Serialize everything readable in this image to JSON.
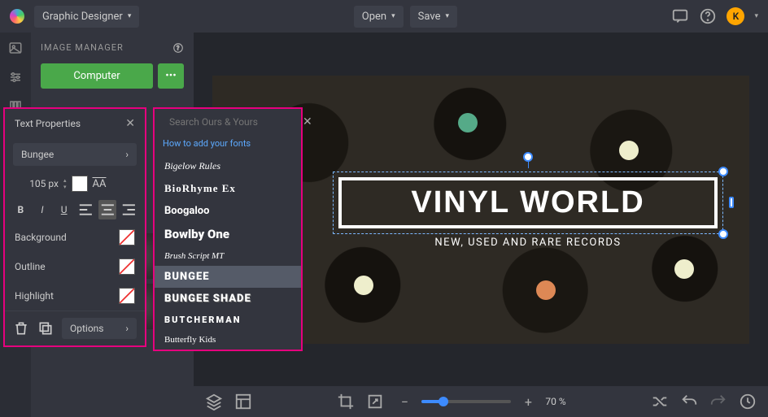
{
  "topbar": {
    "app_mode": "Graphic Designer",
    "open_label": "Open",
    "save_label": "Save",
    "avatar_letter": "K"
  },
  "left_panel": {
    "title": "IMAGE MANAGER",
    "computer_btn": "Computer"
  },
  "text_properties": {
    "title": "Text Properties",
    "font_name": "Bungee",
    "font_size": "105 px",
    "background_label": "Background",
    "outline_label": "Outline",
    "highlight_label": "Highlight",
    "options_label": "Options"
  },
  "font_picker": {
    "placeholder": "Search Ours & Yours",
    "help_link": "How to add your fonts",
    "items": [
      "Bigelow Rules",
      "BioRhyme Ex",
      "Boogaloo",
      "Bowlby One",
      "Brush Script MT",
      "BUNGEE",
      "BUNGEE SHADE",
      "BUTCHERMAN",
      "Butterfly Kids"
    ],
    "selected_index": 5
  },
  "canvas": {
    "headline": "VINYL WORLD",
    "subline": "NEW, USED AND RARE RECORDS"
  },
  "bottombar": {
    "zoom_pct": "70 %"
  }
}
